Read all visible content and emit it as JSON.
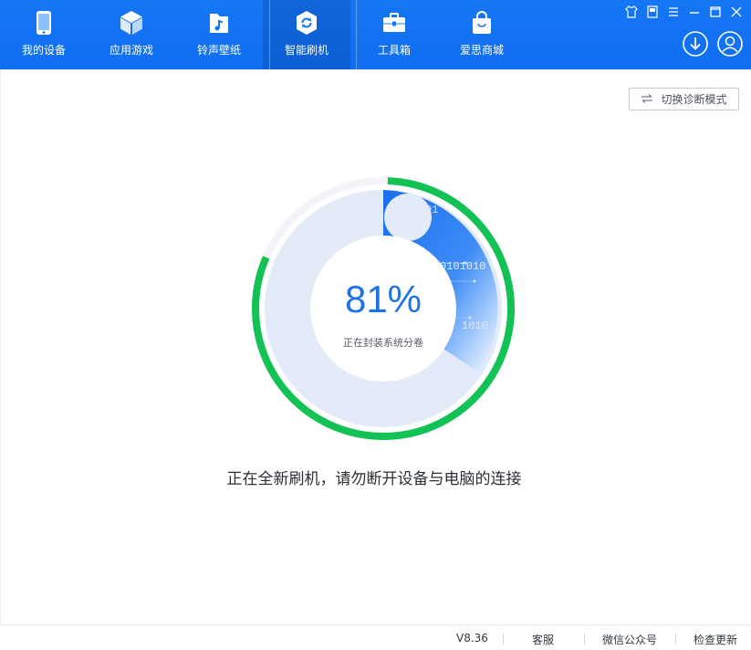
{
  "nav": {
    "items": [
      {
        "label": "我的设备",
        "icon": "phone-icon"
      },
      {
        "label": "应用游戏",
        "icon": "cube-icon"
      },
      {
        "label": "铃声壁纸",
        "icon": "music-folder-icon"
      },
      {
        "label": "智能刷机",
        "icon": "refresh-shield-icon"
      },
      {
        "label": "工具箱",
        "icon": "toolbox-icon"
      },
      {
        "label": "爱思商城",
        "icon": "shopping-bag-icon"
      }
    ],
    "active_index": 3
  },
  "window_controls": [
    "shirt-icon",
    "note-icon",
    "menu-icon",
    "minimize-icon",
    "maximize-icon",
    "close-icon"
  ],
  "header_actions": [
    "download-icon",
    "user-icon"
  ],
  "diagnostic_button": {
    "label": "切换诊断模式",
    "icon": "swap-arrows-icon"
  },
  "progress": {
    "percent_text": "81%",
    "value": 0.81,
    "status": "正在封装系统分卷",
    "binary_text": [
      "01",
      "0101010",
      "1010"
    ]
  },
  "message": "正在全新刷机，请勿断开设备与电脑的连接",
  "footer": {
    "version": "V8.36",
    "service": "客服",
    "wechat": "微信公众号",
    "update": "检查更新"
  },
  "colors": {
    "header_blue": "#1677f5",
    "progress_green": "#12c254",
    "percent_blue": "#1d72e6",
    "ring_light": "#e3eaf8"
  }
}
